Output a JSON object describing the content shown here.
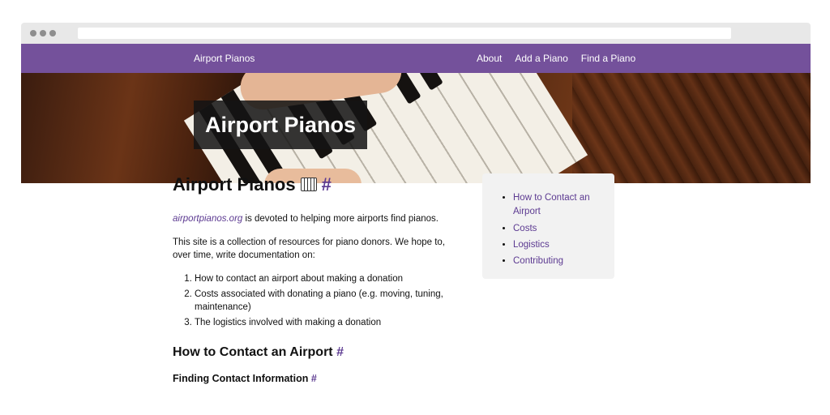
{
  "nav": {
    "brand": "Airport Pianos",
    "links": [
      "About",
      "Add a Piano",
      "Find a Piano"
    ]
  },
  "hero": {
    "title": "Airport Pianos"
  },
  "content": {
    "title": "Airport Pianos",
    "anchor": "#",
    "intro_link": "airportpianos.org",
    "intro_rest": " is devoted to helping more airports find pianos.",
    "paragraph": "This site is a collection of resources for piano donors. We hope to, over time, write documentation on:",
    "list": [
      "How to contact an airport about making a donation",
      "Costs associated with donating a piano (e.g. moving, tuning, maintenance)",
      "The logistics involved with making a donation"
    ],
    "h2": "How to Contact an Airport",
    "h3": "Finding Contact Information"
  },
  "toc": {
    "items": [
      "How to Contact an Airport",
      "Costs",
      "Logistics",
      "Contributing"
    ]
  },
  "colors": {
    "nav": "#74519b",
    "link": "#5c3a91",
    "toc_bg": "#f2f2f2"
  }
}
